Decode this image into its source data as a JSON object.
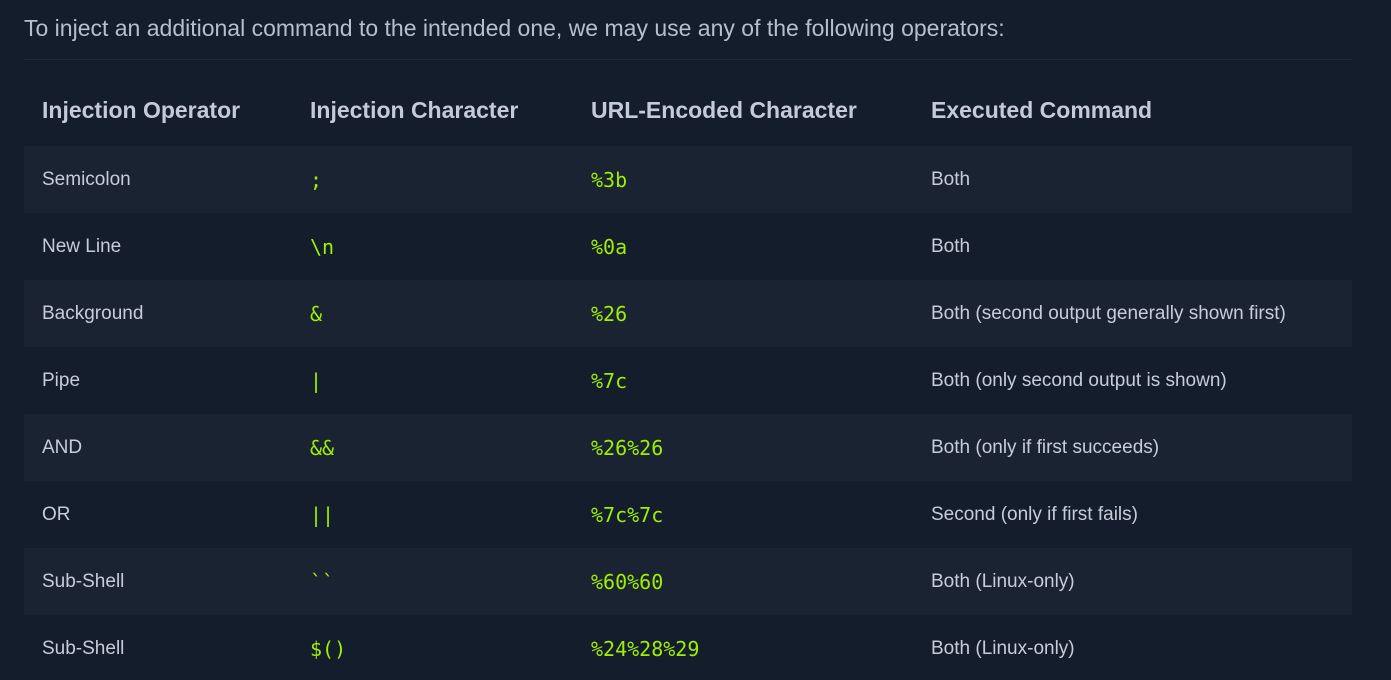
{
  "intro": "To inject an additional command to the intended one, we may use any of the following operators:",
  "table": {
    "headers": [
      "Injection Operator",
      "Injection Character",
      "URL-Encoded Character",
      "Executed Command"
    ],
    "rows": [
      [
        "Semicolon",
        ";",
        "%3b",
        "Both"
      ],
      [
        "New Line",
        "\\n",
        "%0a",
        "Both"
      ],
      [
        "Background",
        "&",
        "%26",
        "Both (second output generally shown first)"
      ],
      [
        "Pipe",
        "|",
        "%7c",
        "Both (only second output is shown)"
      ],
      [
        "AND",
        "&&",
        "%26%26",
        "Both (only if first succeeds)"
      ],
      [
        "OR",
        "||",
        "%7c%7c",
        "Second (only if first fails)"
      ],
      [
        "Sub-Shell",
        "``",
        "%60%60",
        "Both (Linux-only)"
      ],
      [
        "Sub-Shell",
        "$()",
        "%24%28%29",
        "Both (Linux-only)"
      ]
    ]
  },
  "colors": {
    "background": "#141d2b",
    "row_alt": "#1a2332",
    "code": "#9fef00",
    "text": "#c7cdd8"
  }
}
